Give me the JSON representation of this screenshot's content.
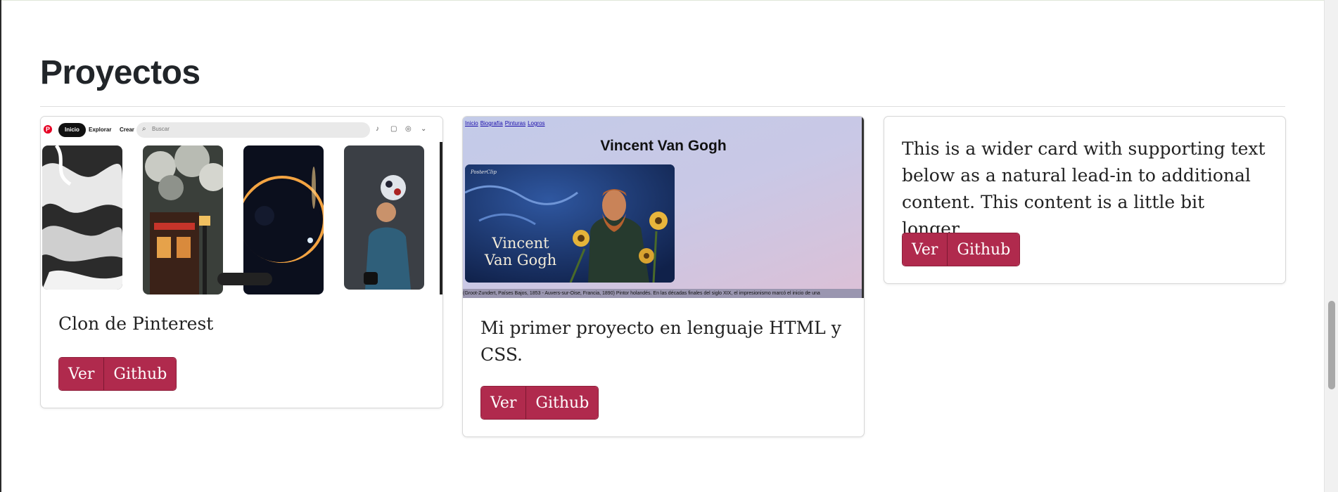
{
  "section": {
    "title": "Proyectos"
  },
  "cards": [
    {
      "text": "Clon de Pinterest",
      "buttons": {
        "view": "Ver",
        "github": "Github"
      },
      "screenshot": {
        "logo": "P",
        "nav": {
          "home": "Inicio",
          "explore": "Explorar",
          "create": "Crear",
          "search_placeholder": "Buscar"
        },
        "icons": [
          "bell-icon",
          "message-icon",
          "profile-icon",
          "chevron-down-icon"
        ]
      }
    },
    {
      "text": "Mi primer proyecto en lenguaje HTML y CSS.",
      "buttons": {
        "view": "Ver",
        "github": "Github"
      },
      "screenshot": {
        "nav": [
          "Inicio",
          "Biografía",
          "Pinturas",
          "Logros"
        ],
        "title": "Vincent Van Gogh",
        "poster": {
          "brand": "PosterClip",
          "line1": "Vincent",
          "line2": "Van Gogh"
        },
        "caption": "(Groot-Zundert, Países Bajos, 1853 - Auvers-sur-Oise, Francia, 1890) Pintor holandés. En las décadas finales del siglo XIX, el impresionismo marcó el inicio de una"
      }
    },
    {
      "text": "This is a wider card with supporting text below as a natural lead-in to additional content. This content is a little bit longer.",
      "buttons": {
        "view": "Ver",
        "github": "Github"
      }
    }
  ],
  "colors": {
    "button": "#b02a4d",
    "pinterest_red": "#e60023"
  }
}
